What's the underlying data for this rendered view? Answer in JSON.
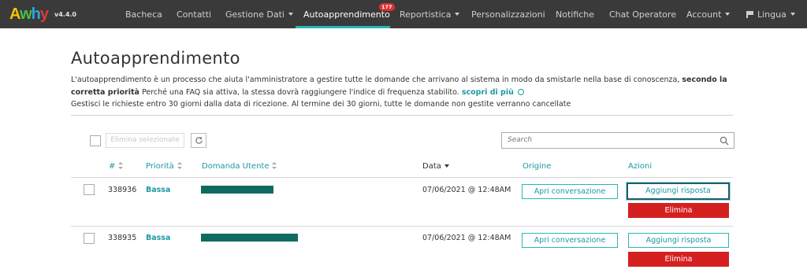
{
  "brand": {
    "name_letters": [
      "A",
      "w",
      "h",
      "y"
    ],
    "name_colors": [
      "#f4c400",
      "#4bbf4a",
      "#2aa7df",
      "#e03a3a"
    ],
    "version": "v4.4.0"
  },
  "nav": {
    "items": [
      "Bacheca",
      "Contatti",
      "Gestione Dati",
      "Autoapprendimento",
      "Reportistica",
      "Personalizzazioni",
      "Notifiche",
      "Chat Operatore",
      "Account",
      "Lingua"
    ],
    "active": "Autoapprendimento",
    "active_badge": "177",
    "accent_color": "#2bb5b8"
  },
  "page": {
    "title": "Autoapprendimento",
    "desc_part1": "L'autoapprendimento è un processo che aiuta l'amministratore a gestire tutte le domande che arrivano al sistema in modo da smistarle nella base di conoscenza, ",
    "desc_bold": "secondo la corretta priorità",
    "desc_part2": " Perché una FAQ sia attiva, la stessa dovrà raggiungere l'indice di frequenza stabilito. ",
    "desc_link": "scopri di più",
    "desc_line2": "Gestisci le richieste entro 30 giorni dalla data di ricezione. Al termine dei 30 giorni, tutte le domande non gestite verranno cancellate"
  },
  "toolbar": {
    "bulk_delete_label": "Elimina selezionate",
    "search_placeholder": "Search"
  },
  "table": {
    "columns": {
      "id": "#",
      "priority": "Priorità",
      "question": "Domanda Utente",
      "date": "Data",
      "origin": "Origine",
      "actions": "Azioni"
    },
    "rows": [
      {
        "id": "338936",
        "priority": "Bassa",
        "date": "07/06/2021 @ 12:48AM"
      },
      {
        "id": "338935",
        "priority": "Bassa",
        "date": "07/06/2021 @ 12:48AM"
      }
    ],
    "open_label": "Apri conversazione",
    "add_answer_label": "Aggiungi risposta",
    "delete_label": "Elimina"
  }
}
